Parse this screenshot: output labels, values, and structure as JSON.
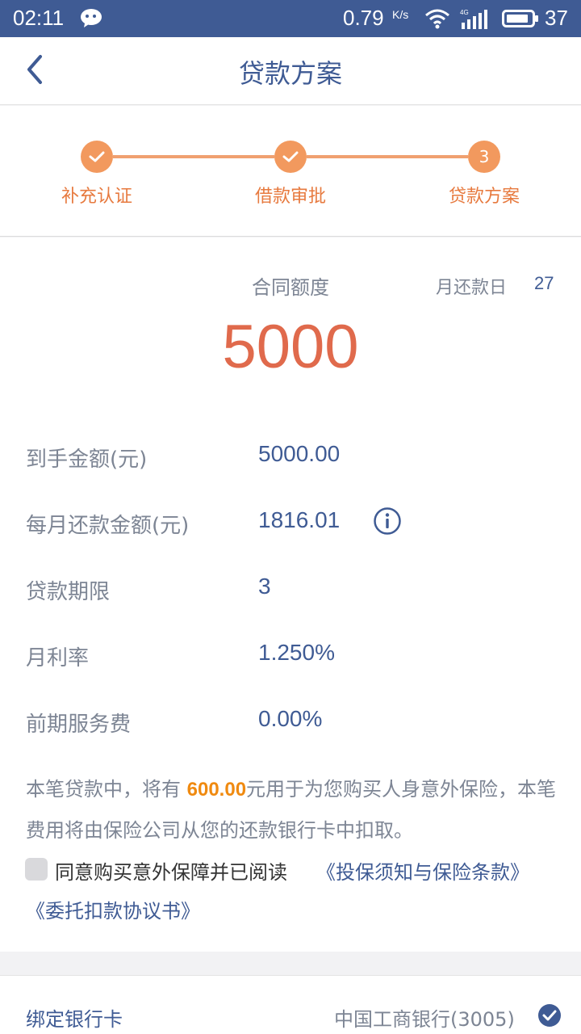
{
  "status_bar": {
    "time": "02:11",
    "speed": "0.79",
    "speed_unit": "K/s",
    "network": "4G",
    "battery": "37"
  },
  "nav": {
    "title": "贷款方案"
  },
  "steps": [
    {
      "label": "补充认证",
      "state": "done"
    },
    {
      "label": "借款审批",
      "state": "done"
    },
    {
      "label": "贷款方案",
      "number": "3",
      "state": "current"
    }
  ],
  "summary": {
    "contract_label": "合同额度",
    "contract_amount": "5000",
    "repay_day_label": "月还款日",
    "repay_day_value": "27"
  },
  "details": [
    {
      "label": "到手金额(元)",
      "value": "5000.00"
    },
    {
      "label": "每月还款金额(元)",
      "value": "1816.01"
    },
    {
      "label": "贷款期限",
      "value": "3"
    },
    {
      "label": "月利率",
      "value": "1.250%"
    },
    {
      "label": "前期服务费",
      "value": "0.00%"
    }
  ],
  "notice": {
    "prefix": "本笔贷款中，将有 ",
    "amount": "600.00",
    "suffix": "元用于为您购买人身意外保险，本笔费用将由保险公司从您的还款银行卡中扣取。"
  },
  "agreement": {
    "text": "同意购买意外保障并已阅读",
    "link_1": "《投保须知与保险条款》",
    "link_2": "《委托扣款协议书》",
    "checked": false
  },
  "bank": {
    "label": "绑定银行卡",
    "value": "中国工商银行(3005)"
  },
  "colors": {
    "primary": "#3f5b94",
    "accent": "#f2995e",
    "amount": "#e06a4c",
    "highlight": "#f08a10"
  }
}
